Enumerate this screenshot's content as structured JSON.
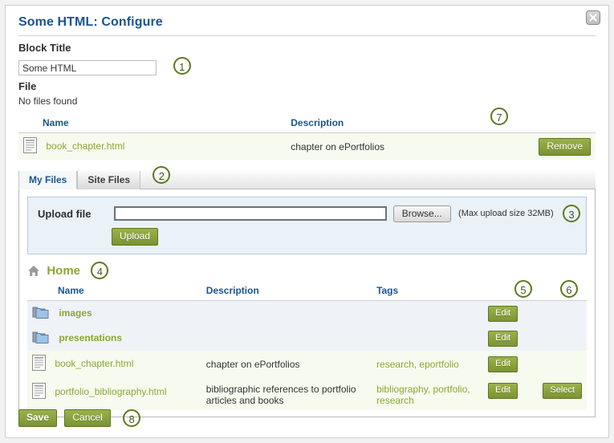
{
  "dialog": {
    "title": "Some HTML: Configure",
    "close_icon": "close-icon"
  },
  "block_title": {
    "label": "Block Title",
    "value": "Some HTML",
    "badge": "1"
  },
  "file_section": {
    "label": "File",
    "empty_text": "No files found",
    "columns": [
      "Name",
      "Description"
    ],
    "rows": [
      {
        "icon": "file-icon",
        "name": "book_chapter.html",
        "description": "chapter on ePortfolios",
        "action_label": "Remove"
      }
    ],
    "remove_badge": "7"
  },
  "tabs": {
    "items": [
      {
        "label": "My Files",
        "active": true
      },
      {
        "label": "Site Files",
        "active": false
      }
    ],
    "badge": "2"
  },
  "upload": {
    "label": "Upload file",
    "value": "",
    "browse_label": "Browse...",
    "max_size_text": "(Max upload size 32MB)",
    "upload_label": "Upload",
    "badge": "3"
  },
  "breadcrumb": {
    "home_label": "Home",
    "home_icon": "home-icon",
    "badge": "4"
  },
  "filelist": {
    "columns": [
      "Name",
      "Description",
      "Tags"
    ],
    "edit_badge": "5",
    "select_badge": "6",
    "rows": [
      {
        "icon": "folder-icon",
        "type": "folder",
        "name": "images",
        "description": "",
        "tags": "",
        "edit_label": "Edit",
        "select_label": ""
      },
      {
        "icon": "folder-icon",
        "type": "folder",
        "name": "presentations",
        "description": "",
        "tags": "",
        "edit_label": "Edit",
        "select_label": ""
      },
      {
        "icon": "file-icon",
        "type": "file",
        "name": "book_chapter.html",
        "description": "chapter on ePortfolios",
        "tags": "research, eportfolio",
        "edit_label": "Edit",
        "select_label": ""
      },
      {
        "icon": "file-icon",
        "type": "file",
        "name": "portfolio_bibliography.html",
        "description": "bibliographic references to portfolio articles and books",
        "tags": "bibliography, portfolio, research",
        "edit_label": "Edit",
        "select_label": "Select"
      }
    ]
  },
  "footer": {
    "save_label": "Save",
    "cancel_label": "Cancel",
    "badge": "8"
  },
  "colors": {
    "heading_blue": "#1a5490",
    "link_green": "#8aa832",
    "button_green": "#7b9432",
    "badge_green": "#5c7a1e",
    "folder_row": "#eff3f7",
    "file_row": "#f7faef"
  }
}
